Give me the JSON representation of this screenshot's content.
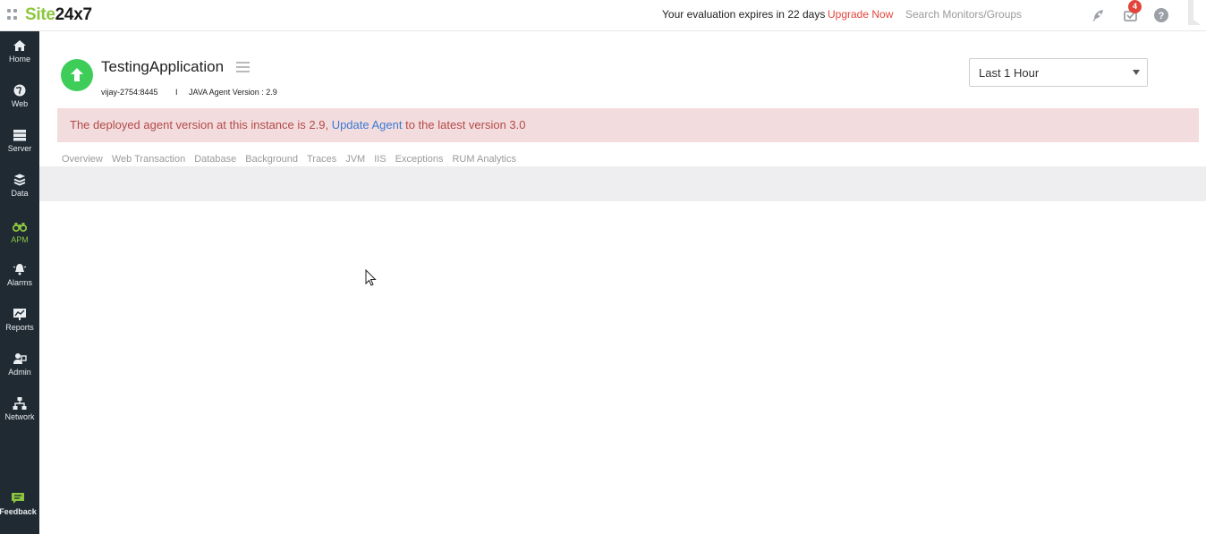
{
  "topbar": {
    "logo_site": "Site",
    "logo_num": "24x7",
    "evaluation_text": "Your evaluation expires in 22 days",
    "upgrade_label": "Upgrade Now",
    "search_placeholder": "Search Monitors/Groups",
    "notification_count": "4",
    "icons": [
      "apps-grid-icon",
      "rocket-icon",
      "notification-icon",
      "help-icon"
    ]
  },
  "sidebar": {
    "items": [
      {
        "label": "Home",
        "icon": "home-icon"
      },
      {
        "label": "Web",
        "icon": "globe-icon"
      },
      {
        "label": "Server",
        "icon": "server-icon"
      },
      {
        "label": "Data",
        "icon": "database-icon"
      },
      {
        "label": "APM",
        "icon": "binoculars-icon",
        "active": true
      },
      {
        "label": "Alarms",
        "icon": "bell-icon"
      },
      {
        "label": "Reports",
        "icon": "report-icon"
      },
      {
        "label": "Admin",
        "icon": "admin-icon"
      },
      {
        "label": "Network",
        "icon": "network-icon"
      },
      {
        "label": "Feedback",
        "icon": "feedback-icon"
      }
    ]
  },
  "header": {
    "title": "TestingApplication",
    "status": "up",
    "host": "vijay-2754:8445",
    "separator": "I",
    "agent_version": "JAVA Agent Version : 2.9",
    "time_range": "Last 1 Hour"
  },
  "alert": {
    "prefix": "The deployed agent version at this instance is 2.9, ",
    "link": "Update Agent",
    "suffix": " to the latest version 3.0"
  },
  "tabs": [
    "Overview",
    "Web Transaction",
    "Database",
    "Background",
    "Traces",
    "JVM",
    "IIS",
    "Exceptions",
    "RUM Analytics"
  ],
  "colors": {
    "brand_green": "#8cc63f",
    "sidebar_bg": "#1f2a33",
    "status_up": "#3dcd58",
    "alert_bg": "#f3dcdd",
    "alert_text": "#b34a4a",
    "link": "#3a7bd5",
    "upgrade": "#e2453c"
  }
}
